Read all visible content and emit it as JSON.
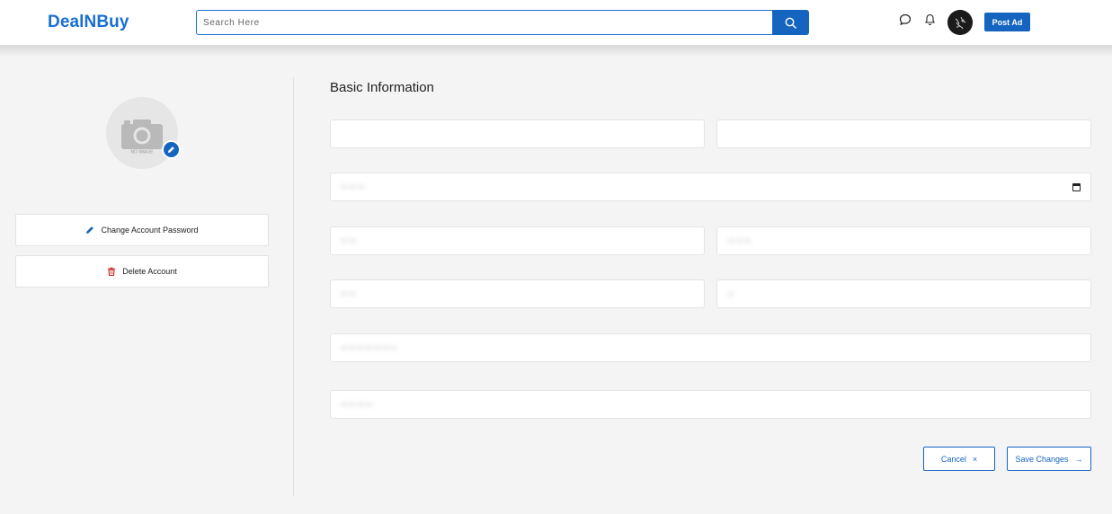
{
  "header": {
    "logo": "DealNBuy",
    "search": {
      "placeholder": "Search Here",
      "value": ""
    },
    "post_ad_label": "Post Ad"
  },
  "profile": {
    "no_image_label": "NO IMAGE"
  },
  "sidebar": {
    "change_password_label": "Change Account Password",
    "delete_account_label": "Delete Account"
  },
  "form": {
    "title": "Basic Information",
    "fields": [
      {
        "value": ""
      },
      {
        "value": ""
      },
      {
        "value": "– – –"
      },
      {
        "value": "– –"
      },
      {
        "value": "– – –"
      },
      {
        "value": "– –"
      },
      {
        "value": "–"
      },
      {
        "value": "– – – – – – –"
      },
      {
        "value": "– – – –"
      }
    ],
    "cancel_label": "Cancel",
    "cancel_icon": "×",
    "save_label": "Save Changes",
    "save_icon": "→"
  },
  "colors": {
    "accent": "#1565c0",
    "logo": "#1a6fd0",
    "danger": "#d32f2f",
    "page_bg": "#f4f4f4"
  },
  "icons": [
    "search-icon",
    "chat-icon",
    "bell-icon",
    "avatar",
    "camera-icon",
    "pencil-icon",
    "trash-icon",
    "calendar-icon",
    "close-icon",
    "arrow-right-icon"
  ]
}
